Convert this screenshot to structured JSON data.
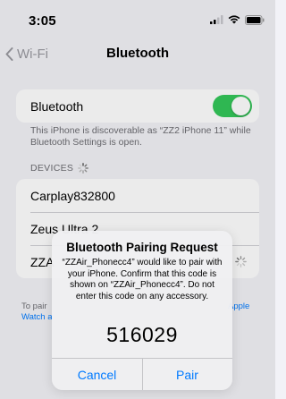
{
  "status_bar": {
    "time": "3:05",
    "icons": [
      "cellular-signal-icon",
      "wifi-icon",
      "battery-icon"
    ]
  },
  "nav": {
    "back_label": "Wi-Fi",
    "title": "Bluetooth"
  },
  "bluetooth": {
    "label": "Bluetooth",
    "enabled": true,
    "discoverable_note": "This iPhone is discoverable as “ZZ2 iPhone 11” while Bluetooth Settings is open."
  },
  "devices": {
    "header": "DEVICES",
    "items": [
      {
        "name": "Carplay832800"
      },
      {
        "name": "Zeus Ultra 2"
      },
      {
        "name": "ZZA"
      }
    ]
  },
  "footer": {
    "text_start": "To pair",
    "text_mid": "Apple",
    "text_end": "Watch a"
  },
  "alert": {
    "title": "Bluetooth Pairing Request",
    "message": "“ZZAir_Phonecc4” would like to pair with your iPhone. Confirm that this code is shown on “ZZAir_Phonecc4”. Do not enter this code on any accessory.",
    "code": "516029",
    "cancel_label": "Cancel",
    "pair_label": "Pair"
  },
  "colors": {
    "accent": "#007aff",
    "toggle_on": "#34c759",
    "background": "#f2f2f7"
  }
}
